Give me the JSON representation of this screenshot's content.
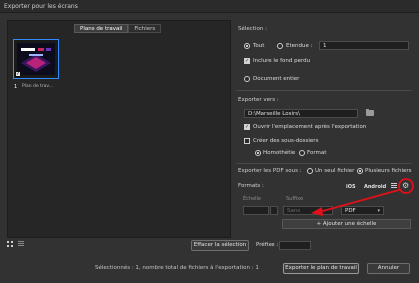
{
  "window": {
    "title": "Exporter pour les écrans"
  },
  "tabs": [
    "Plans de travail",
    "Fichiers"
  ],
  "artboard": {
    "number": "1",
    "name": "Plan de trav..."
  },
  "selection": {
    "title": "Sélection :",
    "all_label": "Tout",
    "range_label": "Etendue :",
    "range_value": "1",
    "bleed_label": "Inclure le fond perdu",
    "whole_doc_label": "Document entier"
  },
  "export_to": {
    "title": "Exporter vers :",
    "path": "D:\\Marseille Losirs\\",
    "open_after_label": "Ouvrir l'emplacement après l'exportation",
    "subfolders_label": "Créer des sous-dossiers",
    "homothetie_label": "Homothétie",
    "format_label": "Format"
  },
  "pdf_as": {
    "title": "Exporter les PDF sous :",
    "single_label": "Un seul fichier",
    "multi_label": "Plusieurs fichiers"
  },
  "formats": {
    "title": "Formats :",
    "ios": "iOS",
    "android": "Android",
    "col_scale": "Échelle",
    "col_suffix": "Suffixe",
    "suffix_placeholder": "Sans",
    "format_value": "PDF",
    "add_scale_label": "+ Ajouter une échelle"
  },
  "bottom": {
    "clear_selection": "Effacer la sélection",
    "prefix_label": "Préfixe :",
    "status": "Sélectionnés : 1, nombre total de fichiers à l'exportation : 1",
    "export_button": "Exporter le plan de travail",
    "cancel_button": "Annuler"
  },
  "colors": {
    "accent": "#2f8bff",
    "annotation": "#e0101a",
    "background": "#323232"
  }
}
